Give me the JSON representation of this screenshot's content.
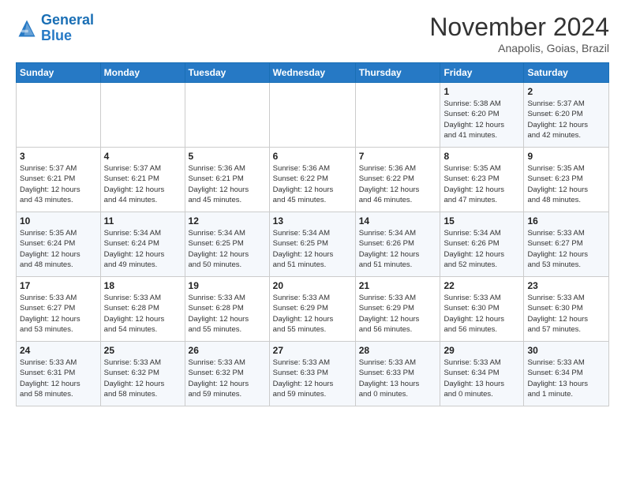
{
  "logo": {
    "line1": "General",
    "line2": "Blue"
  },
  "header": {
    "month": "November 2024",
    "location": "Anapolis, Goias, Brazil"
  },
  "weekdays": [
    "Sunday",
    "Monday",
    "Tuesday",
    "Wednesday",
    "Thursday",
    "Friday",
    "Saturday"
  ],
  "weeks": [
    [
      {
        "day": "",
        "info": ""
      },
      {
        "day": "",
        "info": ""
      },
      {
        "day": "",
        "info": ""
      },
      {
        "day": "",
        "info": ""
      },
      {
        "day": "",
        "info": ""
      },
      {
        "day": "1",
        "info": "Sunrise: 5:38 AM\nSunset: 6:20 PM\nDaylight: 12 hours\nand 41 minutes."
      },
      {
        "day": "2",
        "info": "Sunrise: 5:37 AM\nSunset: 6:20 PM\nDaylight: 12 hours\nand 42 minutes."
      }
    ],
    [
      {
        "day": "3",
        "info": "Sunrise: 5:37 AM\nSunset: 6:21 PM\nDaylight: 12 hours\nand 43 minutes."
      },
      {
        "day": "4",
        "info": "Sunrise: 5:37 AM\nSunset: 6:21 PM\nDaylight: 12 hours\nand 44 minutes."
      },
      {
        "day": "5",
        "info": "Sunrise: 5:36 AM\nSunset: 6:21 PM\nDaylight: 12 hours\nand 45 minutes."
      },
      {
        "day": "6",
        "info": "Sunrise: 5:36 AM\nSunset: 6:22 PM\nDaylight: 12 hours\nand 45 minutes."
      },
      {
        "day": "7",
        "info": "Sunrise: 5:36 AM\nSunset: 6:22 PM\nDaylight: 12 hours\nand 46 minutes."
      },
      {
        "day": "8",
        "info": "Sunrise: 5:35 AM\nSunset: 6:23 PM\nDaylight: 12 hours\nand 47 minutes."
      },
      {
        "day": "9",
        "info": "Sunrise: 5:35 AM\nSunset: 6:23 PM\nDaylight: 12 hours\nand 48 minutes."
      }
    ],
    [
      {
        "day": "10",
        "info": "Sunrise: 5:35 AM\nSunset: 6:24 PM\nDaylight: 12 hours\nand 48 minutes."
      },
      {
        "day": "11",
        "info": "Sunrise: 5:34 AM\nSunset: 6:24 PM\nDaylight: 12 hours\nand 49 minutes."
      },
      {
        "day": "12",
        "info": "Sunrise: 5:34 AM\nSunset: 6:25 PM\nDaylight: 12 hours\nand 50 minutes."
      },
      {
        "day": "13",
        "info": "Sunrise: 5:34 AM\nSunset: 6:25 PM\nDaylight: 12 hours\nand 51 minutes."
      },
      {
        "day": "14",
        "info": "Sunrise: 5:34 AM\nSunset: 6:26 PM\nDaylight: 12 hours\nand 51 minutes."
      },
      {
        "day": "15",
        "info": "Sunrise: 5:34 AM\nSunset: 6:26 PM\nDaylight: 12 hours\nand 52 minutes."
      },
      {
        "day": "16",
        "info": "Sunrise: 5:33 AM\nSunset: 6:27 PM\nDaylight: 12 hours\nand 53 minutes."
      }
    ],
    [
      {
        "day": "17",
        "info": "Sunrise: 5:33 AM\nSunset: 6:27 PM\nDaylight: 12 hours\nand 53 minutes."
      },
      {
        "day": "18",
        "info": "Sunrise: 5:33 AM\nSunset: 6:28 PM\nDaylight: 12 hours\nand 54 minutes."
      },
      {
        "day": "19",
        "info": "Sunrise: 5:33 AM\nSunset: 6:28 PM\nDaylight: 12 hours\nand 55 minutes."
      },
      {
        "day": "20",
        "info": "Sunrise: 5:33 AM\nSunset: 6:29 PM\nDaylight: 12 hours\nand 55 minutes."
      },
      {
        "day": "21",
        "info": "Sunrise: 5:33 AM\nSunset: 6:29 PM\nDaylight: 12 hours\nand 56 minutes."
      },
      {
        "day": "22",
        "info": "Sunrise: 5:33 AM\nSunset: 6:30 PM\nDaylight: 12 hours\nand 56 minutes."
      },
      {
        "day": "23",
        "info": "Sunrise: 5:33 AM\nSunset: 6:30 PM\nDaylight: 12 hours\nand 57 minutes."
      }
    ],
    [
      {
        "day": "24",
        "info": "Sunrise: 5:33 AM\nSunset: 6:31 PM\nDaylight: 12 hours\nand 58 minutes."
      },
      {
        "day": "25",
        "info": "Sunrise: 5:33 AM\nSunset: 6:32 PM\nDaylight: 12 hours\nand 58 minutes."
      },
      {
        "day": "26",
        "info": "Sunrise: 5:33 AM\nSunset: 6:32 PM\nDaylight: 12 hours\nand 59 minutes."
      },
      {
        "day": "27",
        "info": "Sunrise: 5:33 AM\nSunset: 6:33 PM\nDaylight: 12 hours\nand 59 minutes."
      },
      {
        "day": "28",
        "info": "Sunrise: 5:33 AM\nSunset: 6:33 PM\nDaylight: 13 hours\nand 0 minutes."
      },
      {
        "day": "29",
        "info": "Sunrise: 5:33 AM\nSunset: 6:34 PM\nDaylight: 13 hours\nand 0 minutes."
      },
      {
        "day": "30",
        "info": "Sunrise: 5:33 AM\nSunset: 6:34 PM\nDaylight: 13 hours\nand 1 minute."
      }
    ]
  ]
}
